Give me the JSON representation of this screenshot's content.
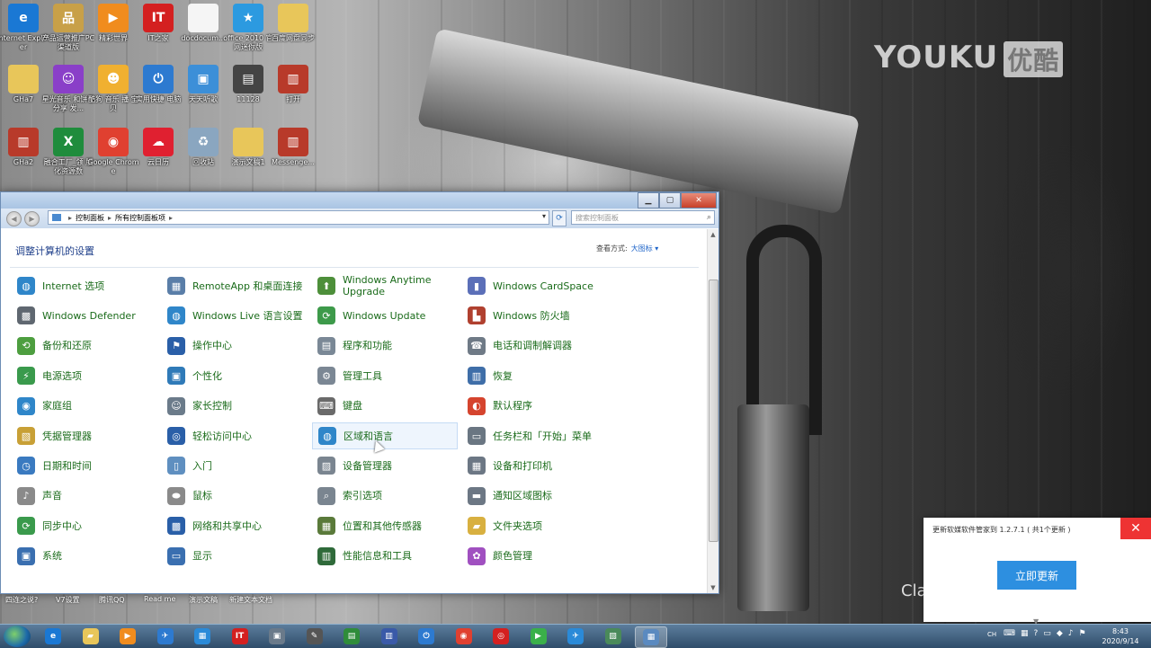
{
  "desktop": {
    "watermark": {
      "brand": "YOUKU",
      "cn": "优酷"
    },
    "partial_text": "Cla",
    "icons_row1": [
      {
        "label": "Internet Explorer",
        "icon": "ie-icon",
        "color": "#1a78d4",
        "glyph": "e"
      },
      {
        "label": "产品运营推广PC渠道版",
        "icon": "app-icon",
        "color": "#c8a048",
        "glyph": "品"
      },
      {
        "label": "精彩世界",
        "icon": "media-icon",
        "color": "#f08c1e",
        "glyph": "▶"
      },
      {
        "label": "IT之家",
        "icon": "it-icon",
        "color": "#d42020",
        "glyph": "IT"
      },
      {
        "label": "docdocum...",
        "icon": "document-icon",
        "color": "#f5f5f5",
        "glyph": ""
      },
      {
        "label": "office 2010 官网迷你版",
        "icon": "star-icon",
        "color": "#2c9ae0",
        "glyph": "★"
      },
      {
        "label": "百度网盘同步",
        "icon": "folder-icon",
        "color": "#e8c65a",
        "glyph": ""
      }
    ],
    "icons_row2": [
      {
        "label": "GHa7",
        "icon": "folder-icon",
        "color": "#e8c65a",
        "glyph": ""
      },
      {
        "label": "星光音乐 和饼干 分享 发...",
        "icon": "skull-icon",
        "color": "#8a3fc8",
        "glyph": "☺"
      },
      {
        "label": "酷狗 音乐 播 宝贝",
        "icon": "face-icon",
        "color": "#f0b030",
        "glyph": "☻"
      },
      {
        "label": "实用快捷 电脑",
        "icon": "power-icon",
        "color": "#2d7ad0",
        "glyph": "⏻"
      },
      {
        "label": "天天听歌",
        "icon": "monitor-icon",
        "color": "#3c8fd8",
        "glyph": "▣"
      },
      {
        "label": "11128",
        "icon": "film-icon",
        "color": "#444444",
        "glyph": "▤"
      },
      {
        "label": "打开",
        "icon": "archive-icon",
        "color": "#b83a2a",
        "glyph": "▥"
      }
    ],
    "icons_row3": [
      {
        "label": "GHa2",
        "icon": "archive-icon",
        "color": "#b83a2a",
        "glyph": "▥"
      },
      {
        "label": "融合工厂_领 版化资源数",
        "icon": "excel-icon",
        "color": "#1f8c3c",
        "glyph": "X"
      },
      {
        "label": "Google Chrome",
        "icon": "chrome-icon",
        "color": "#e04030",
        "glyph": "◉"
      },
      {
        "label": "云日历",
        "icon": "cloud-icon",
        "color": "#e02030",
        "glyph": "☁"
      },
      {
        "label": "回收站",
        "icon": "recycle-bin-icon",
        "color": "#8aa6c0",
        "glyph": "♻"
      },
      {
        "label": "演示文稿1",
        "icon": "folder-icon",
        "color": "#e8c65a",
        "glyph": ""
      },
      {
        "label": "Messenge...",
        "icon": "archive-icon",
        "color": "#b83a2a",
        "glyph": "▥"
      }
    ],
    "bottom_icon_labels": [
      "四连之说?",
      "V7设置",
      "腾讯QQ",
      "Read me",
      "演示文稿",
      "新建文本文档"
    ]
  },
  "window": {
    "breadcrumb": [
      "控制面板",
      "所有控制面板项"
    ],
    "search_placeholder": "搜索控制面板",
    "heading": "调整计算机的设置",
    "view_by_label": "查看方式:",
    "view_by_value": "大图标 ▾",
    "items": [
      {
        "label": "Internet 选项",
        "icon": "globe-icon",
        "color": "#2f86c9",
        "glyph": "◍"
      },
      {
        "label": "RemoteApp 和桌面连接",
        "icon": "remote-icon",
        "color": "#5a7ea8",
        "glyph": "▦"
      },
      {
        "label": "Windows Anytime Upgrade",
        "icon": "upgrade-icon",
        "color": "#4d8f3a",
        "glyph": "⬆"
      },
      {
        "label": "Windows CardSpace",
        "icon": "card-icon",
        "color": "#5b6fb8",
        "glyph": "▮"
      },
      {
        "label": "Windows Defender",
        "icon": "defender-icon",
        "color": "#5f6770",
        "glyph": "▩"
      },
      {
        "label": "Windows Live 语言设置",
        "icon": "globe-icon",
        "color": "#2f86c9",
        "glyph": "◍"
      },
      {
        "label": "Windows Update",
        "icon": "update-icon",
        "color": "#3d9a4a",
        "glyph": "⟳"
      },
      {
        "label": "Windows 防火墙",
        "icon": "firewall-icon",
        "color": "#b0402f",
        "glyph": "▙"
      },
      {
        "label": "备份和还原",
        "icon": "backup-icon",
        "color": "#4d9e3f",
        "glyph": "⟲"
      },
      {
        "label": "操作中心",
        "icon": "flag-icon",
        "color": "#2a5fa8",
        "glyph": "⚑"
      },
      {
        "label": "程序和功能",
        "icon": "programs-icon",
        "color": "#7a8896",
        "glyph": "▤"
      },
      {
        "label": "电话和调制解调器",
        "icon": "phone-icon",
        "color": "#6f7a86",
        "glyph": "☎"
      },
      {
        "label": "电源选项",
        "icon": "power-options-icon",
        "color": "#3a9a4c",
        "glyph": "⚡"
      },
      {
        "label": "个性化",
        "icon": "personalize-icon",
        "color": "#2f7ab8",
        "glyph": "▣"
      },
      {
        "label": "管理工具",
        "icon": "tools-icon",
        "color": "#7b8794",
        "glyph": "⚙"
      },
      {
        "label": "恢复",
        "icon": "recovery-icon",
        "color": "#3f6ea8",
        "glyph": "▥"
      },
      {
        "label": "家庭组",
        "icon": "homegroup-icon",
        "color": "#2f86c9",
        "glyph": "◉"
      },
      {
        "label": "家长控制",
        "icon": "parental-icon",
        "color": "#6b7b8a",
        "glyph": "☺"
      },
      {
        "label": "键盘",
        "icon": "keyboard-icon",
        "color": "#6a6a6a",
        "glyph": "⌨"
      },
      {
        "label": "默认程序",
        "icon": "default-programs-icon",
        "color": "#d5442e",
        "glyph": "◐"
      },
      {
        "label": "凭据管理器",
        "icon": "credential-icon",
        "color": "#c8a036",
        "glyph": "▧"
      },
      {
        "label": "轻松访问中心",
        "icon": "ease-access-icon",
        "color": "#2a5fa8",
        "glyph": "◎"
      },
      {
        "label": "区域和语言",
        "icon": "region-icon",
        "color": "#2f86c9",
        "glyph": "◍"
      },
      {
        "label": "任务栏和「开始」菜单",
        "icon": "taskbar-icon",
        "color": "#6a7682",
        "glyph": "▭"
      },
      {
        "label": "日期和时间",
        "icon": "clock-icon",
        "color": "#3a7ac0",
        "glyph": "◷"
      },
      {
        "label": "入门",
        "icon": "getting-started-icon",
        "color": "#5f8fc0",
        "glyph": "▯"
      },
      {
        "label": "设备管理器",
        "icon": "device-manager-icon",
        "color": "#7a8590",
        "glyph": "▨"
      },
      {
        "label": "设备和打印机",
        "icon": "printer-icon",
        "color": "#6c7784",
        "glyph": "▦"
      },
      {
        "label": "声音",
        "icon": "sound-icon",
        "color": "#8a8a8a",
        "glyph": "♪"
      },
      {
        "label": "鼠标",
        "icon": "mouse-icon",
        "color": "#8a8a8a",
        "glyph": "⬬"
      },
      {
        "label": "索引选项",
        "icon": "index-icon",
        "color": "#7a8590",
        "glyph": "⌕"
      },
      {
        "label": "通知区域图标",
        "icon": "notification-icon",
        "color": "#6c7784",
        "glyph": "▬"
      },
      {
        "label": "同步中心",
        "icon": "sync-icon",
        "color": "#3a9a4c",
        "glyph": "⟳"
      },
      {
        "label": "网络和共享中心",
        "icon": "network-icon",
        "color": "#2a5fa8",
        "glyph": "▩"
      },
      {
        "label": "位置和其他传感器",
        "icon": "sensor-icon",
        "color": "#5a7a3a",
        "glyph": "▦"
      },
      {
        "label": "文件夹选项",
        "icon": "folder-options-icon",
        "color": "#d8b040",
        "glyph": "▰"
      },
      {
        "label": "系统",
        "icon": "system-icon",
        "color": "#3a6fb0",
        "glyph": "▣"
      },
      {
        "label": "显示",
        "icon": "display-icon",
        "color": "#3a6fb0",
        "glyph": "▭"
      },
      {
        "label": "性能信息和工具",
        "icon": "performance-icon",
        "color": "#2f6a3a",
        "glyph": "▥"
      },
      {
        "label": "颜色管理",
        "icon": "color-icon",
        "color": "#a050c0",
        "glyph": "✿"
      }
    ]
  },
  "popup": {
    "message": "更新软媒软件管家到 1.2.7.1 ( 共1个更新 )",
    "button": "立即更新",
    "close": "✕"
  },
  "taskbar": {
    "apps": [
      {
        "name": "ie",
        "color": "#1a78d4",
        "glyph": "e"
      },
      {
        "name": "explorer",
        "color": "#e8c65a",
        "glyph": "▰"
      },
      {
        "name": "media",
        "color": "#f08c1e",
        "glyph": "▶"
      },
      {
        "name": "bird",
        "color": "#2d7ad0",
        "glyph": "✈"
      },
      {
        "name": "store",
        "color": "#2a8ad8",
        "glyph": "▦"
      },
      {
        "name": "ithome",
        "color": "#d42020",
        "glyph": "IT"
      },
      {
        "name": "computer",
        "color": "#6a7a8a",
        "glyph": "▣"
      },
      {
        "name": "pen",
        "color": "#555555",
        "glyph": "✎"
      },
      {
        "name": "monitor",
        "color": "#2f8c3a",
        "glyph": "▤"
      },
      {
        "name": "screen",
        "color": "#3a5aa8",
        "glyph": "▥"
      },
      {
        "name": "power",
        "color": "#2d7ad0",
        "glyph": "⏻"
      },
      {
        "name": "chrome",
        "color": "#e04030",
        "glyph": "◉"
      },
      {
        "name": "music",
        "color": "#d42020",
        "glyph": "◎"
      },
      {
        "name": "play",
        "color": "#3ab04a",
        "glyph": "▶"
      },
      {
        "name": "plane",
        "color": "#2a8ad8",
        "glyph": "✈"
      },
      {
        "name": "doc",
        "color": "#4a8a5a",
        "glyph": "▧"
      },
      {
        "name": "control-panel",
        "color": "#5a8ac0",
        "glyph": "▦"
      }
    ],
    "ime": "CH",
    "time": "8:43",
    "date": "2020/9/14"
  }
}
